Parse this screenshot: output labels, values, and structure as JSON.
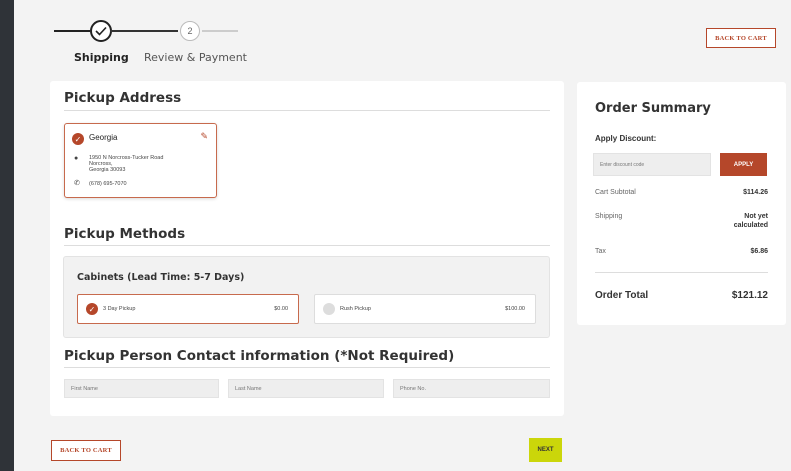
{
  "stepper": {
    "step1_label": "Shipping",
    "step1_icon": "check-icon",
    "step2_number": "2",
    "step2_label": "Review & Payment"
  },
  "header": {
    "back_to_cart": "BACK TO CART"
  },
  "pickup_address": {
    "title": "Pickup Address",
    "name": "Georgia",
    "line1": "1950 N Norcross-Tucker Road",
    "line2": "Norcross,",
    "line3": "Georgia 30093",
    "phone": "(678) 695-7070"
  },
  "pickup_methods": {
    "title": "Pickup Methods",
    "subtitle": "Cabinets (Lead Time: 5-7 Days)",
    "options": [
      {
        "label": "3 Day Pickup",
        "price": "$0.00",
        "selected": true
      },
      {
        "label": "Rush Pickup",
        "price": "$100.00",
        "selected": false
      }
    ]
  },
  "contact": {
    "title": "Pickup Person Contact information (*Not Required)",
    "first_name_placeholder": "First Name",
    "last_name_placeholder": "Last Name",
    "phone_placeholder": "Phone No."
  },
  "order_summary": {
    "title": "Order Summary",
    "apply_discount_label": "Apply Discount:",
    "discount_placeholder": "Enter discount code",
    "apply_button": "APPLY",
    "cart_subtotal_label": "Cart Subtotal",
    "cart_subtotal_value": "$114.26",
    "shipping_label": "Shipping",
    "shipping_value_1": "Not yet",
    "shipping_value_2": "calculated",
    "tax_label": "Tax",
    "tax_value": "$6.86",
    "total_label": "Order Total",
    "total_value": "$121.12"
  },
  "footer": {
    "back_to_cart": "BACK TO CART",
    "next": "NEXT"
  },
  "colors": {
    "accent": "#b5472a",
    "next_button": "#cbd60a",
    "background": "#f3f3f3"
  }
}
